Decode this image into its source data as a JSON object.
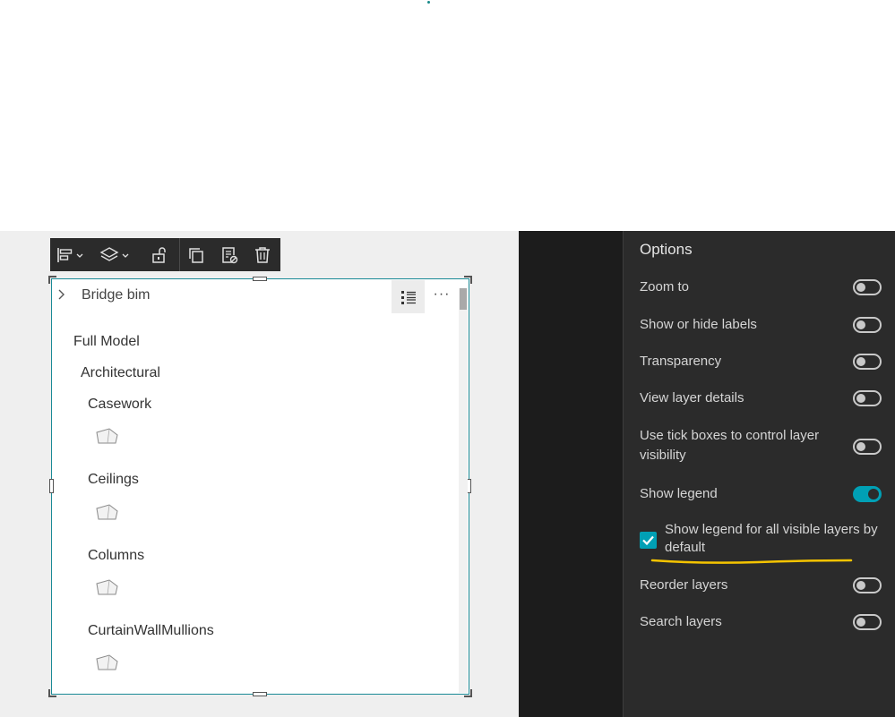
{
  "widget": {
    "title": "Bridge bim",
    "tree": [
      {
        "label": "Full Model",
        "level": 0
      },
      {
        "label": "Architectural",
        "level": 1
      },
      {
        "label": "Casework",
        "level": 2
      },
      {
        "label": "Ceilings",
        "level": 2
      },
      {
        "label": "Columns",
        "level": 2
      },
      {
        "label": "CurtainWallMullions",
        "level": 2
      }
    ],
    "more_label": "···"
  },
  "toolbar": {
    "icons": [
      "align-left-icon",
      "layers-icon",
      "unlock-icon",
      "duplicate-icon",
      "edit-data-icon",
      "delete-icon"
    ]
  },
  "options": {
    "title": "Options",
    "items": [
      {
        "label": "Zoom to",
        "on": false
      },
      {
        "label": "Show or hide labels",
        "on": false
      },
      {
        "label": "Transparency",
        "on": false
      },
      {
        "label": "View layer details",
        "on": false
      },
      {
        "label": "Use tick boxes to control layer visibility",
        "on": false
      },
      {
        "label": "Show legend",
        "on": true
      },
      {
        "label": "Reorder layers",
        "on": false
      },
      {
        "label": "Search layers",
        "on": false
      }
    ],
    "checkbox": {
      "label": "Show legend for all visible layers by default",
      "checked": true
    }
  },
  "colors": {
    "accent": "#00a0b5",
    "highlight": "#f5c400",
    "panel_bg": "#2b2b2b"
  }
}
